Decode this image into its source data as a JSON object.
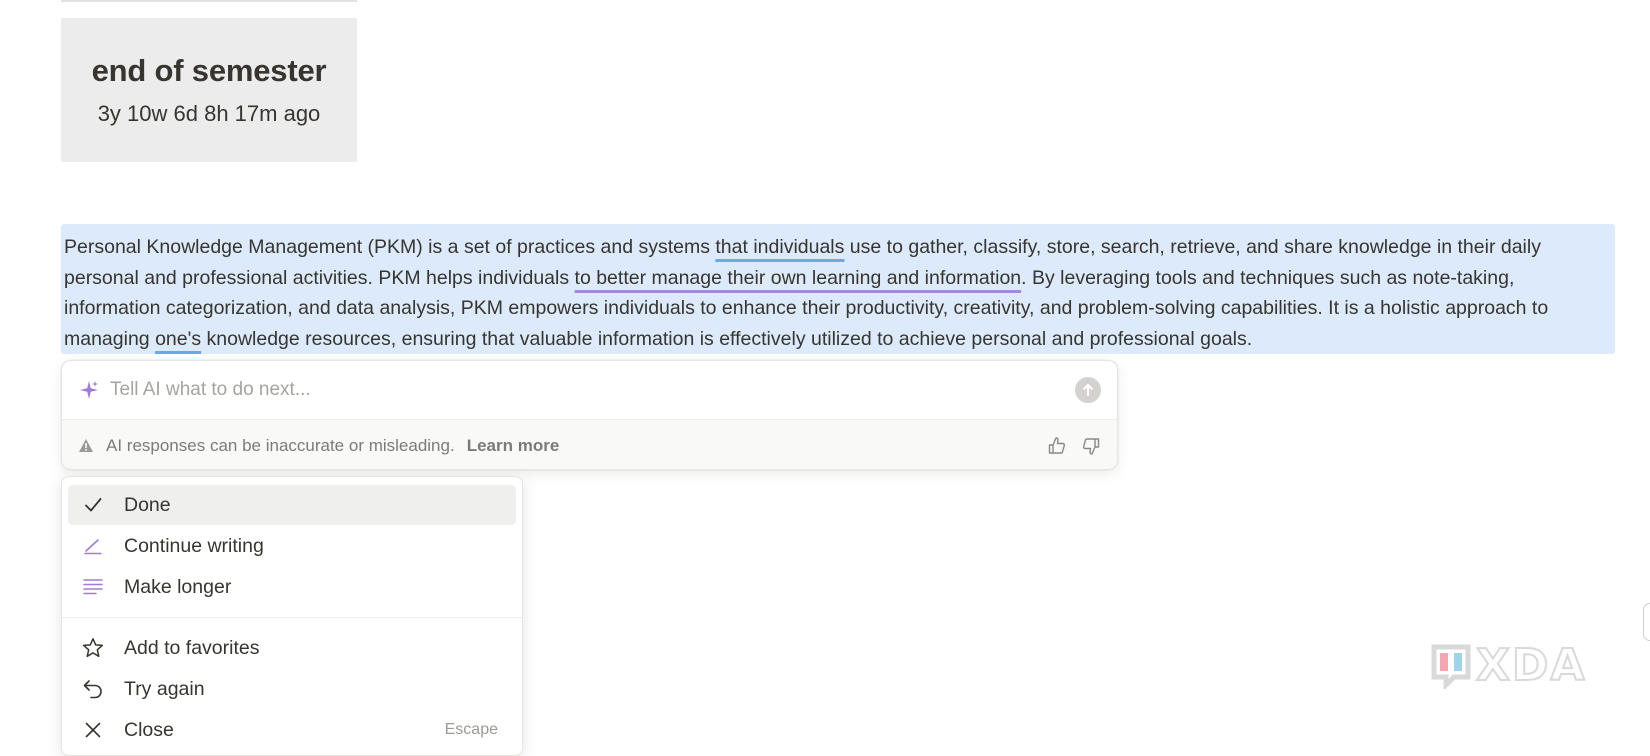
{
  "countdown": {
    "title": "end of semester",
    "elapsed": "3y 10w 6d 8h 17m ago"
  },
  "selection": {
    "p1": "Personal Knowledge Management (PKM) is a set of practices and systems ",
    "u1": "that individuals",
    "p2": " use to gather, classify, store, search, retrieve, and share knowledge in their daily personal and professional activities. PKM helps individuals ",
    "u2": "to better manage their own learning and information",
    "p3": ". By leveraging tools and techniques such as note-taking, information categorization, and data analysis, PKM empowers individuals to enhance their productivity, creativity, and problem-solving capabilities. It is a holistic approach to managing ",
    "u3": "one's",
    "p4": " knowledge resources, ensuring that valuable information is effectively utilized to achieve personal and professional goals."
  },
  "ai": {
    "placeholder": "Tell AI what to do next...",
    "disclaimer": "AI responses can be inaccurate or misleading.",
    "learn_more": "Learn more"
  },
  "menu": {
    "items": [
      {
        "label": "Done",
        "icon": "check-icon"
      },
      {
        "label": "Continue writing",
        "icon": "pen-icon"
      },
      {
        "label": "Make longer",
        "icon": "lines-icon"
      }
    ],
    "items2": [
      {
        "label": "Add to favorites",
        "icon": "star-icon"
      },
      {
        "label": "Try again",
        "icon": "undo-icon"
      },
      {
        "label": "Close",
        "icon": "close-icon",
        "shortcut": "Escape"
      }
    ]
  },
  "colors": {
    "selection_bg": "#dceafb",
    "underline_blue": "#6aa8e6",
    "underline_purple": "#a888d8",
    "ai_accent": "#a27bd6"
  },
  "watermark": {
    "text": "XDA"
  }
}
